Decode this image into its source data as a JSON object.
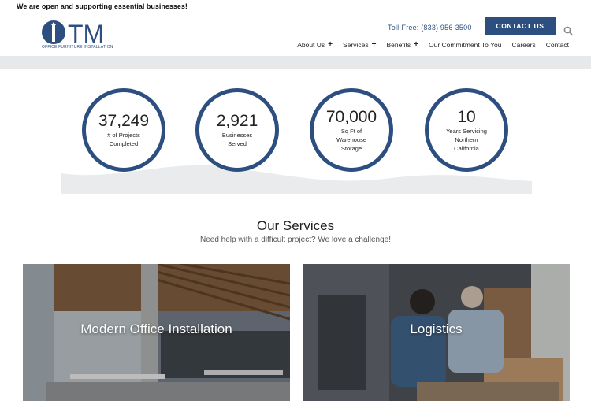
{
  "topbar": {
    "message": "We are open and supporting essential businesses!"
  },
  "logo": {
    "text": "OTM",
    "tagline": "OFFICE FURNITURE INSTALLATION"
  },
  "header": {
    "tollfree": "Toll-Free: (833) 956-3500",
    "contact_label": "CONTACT US",
    "search_icon": "search-icon"
  },
  "nav": {
    "items": [
      {
        "label": "About Us",
        "has_submenu": true
      },
      {
        "label": "Services",
        "has_submenu": true
      },
      {
        "label": "Benefits",
        "has_submenu": true
      },
      {
        "label": "Our Commitment To You",
        "has_submenu": false
      },
      {
        "label": "Careers",
        "has_submenu": false
      },
      {
        "label": "Contact",
        "has_submenu": false
      }
    ]
  },
  "stats": [
    {
      "number": "37,249",
      "label": "# of Projects Completed"
    },
    {
      "number": "2,921",
      "label": "Businesses Served"
    },
    {
      "number": "70,000",
      "label": "Sq Ft of Warehouse Storage"
    },
    {
      "number": "10",
      "label": "Years Servicing Northern California"
    }
  ],
  "services": {
    "title": "Our Services",
    "subtitle": "Need help with a difficult project? We love a challenge!",
    "cards": [
      {
        "title": "Modern Office Installation"
      },
      {
        "title": "Logistics"
      }
    ]
  },
  "colors": {
    "brand": "#2d4f7f",
    "band": "#e6e8ea"
  }
}
